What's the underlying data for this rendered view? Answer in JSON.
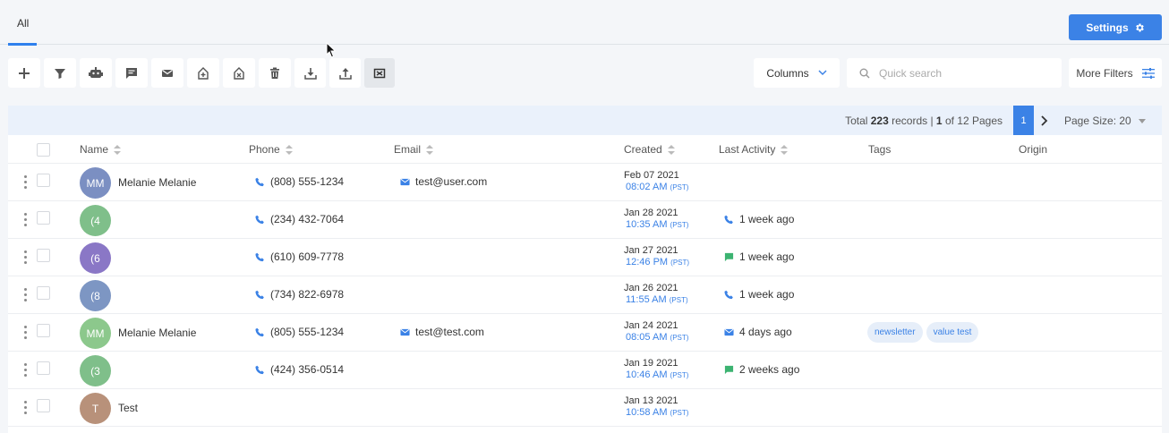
{
  "tabs": [
    {
      "label": "All"
    }
  ],
  "settings_label": "Settings",
  "toolbar": {
    "icons": [
      "plus-icon",
      "filter-icon",
      "robot-icon",
      "chat-icon",
      "mail-icon",
      "tag-add-icon",
      "tag-remove-icon",
      "trash-icon",
      "download-icon",
      "upload-icon",
      "merge-icon"
    ]
  },
  "columns_label": "Columns",
  "search": {
    "placeholder": "Quick search",
    "value": ""
  },
  "more_filters_label": "More Filters",
  "pagination": {
    "total_prefix": "Total ",
    "total_count": "223",
    "records_text": " records | ",
    "page_current": "1",
    "of_text": " of 12 Pages",
    "page_button": "1",
    "page_size": "Page Size: 20"
  },
  "headers": {
    "name": "Name",
    "phone": "Phone",
    "email": "Email",
    "created": "Created",
    "last_activity": "Last Activity",
    "tags": "Tags",
    "origin": "Origin"
  },
  "rows": [
    {
      "initials": "MM",
      "color": "#7b8fc2",
      "name": "Melanie Melanie",
      "phone": "(808) 555-1234",
      "email": "test@user.com",
      "date": "Feb 07 2021",
      "time": "08:02 AM",
      "tz": "(PST)",
      "activity_icon": "",
      "activity": "",
      "tags": []
    },
    {
      "initials": "(4",
      "color": "#7fbf8a",
      "name": "",
      "phone": "(234) 432-7064",
      "email": "",
      "date": "Jan 28 2021",
      "time": "10:35 AM",
      "tz": "(PST)",
      "activity_icon": "phone",
      "activity": "1 week ago",
      "tags": []
    },
    {
      "initials": "(6",
      "color": "#8a77c6",
      "name": "",
      "phone": "(610) 609-7778",
      "email": "",
      "date": "Jan 27 2021",
      "time": "12:46 PM",
      "tz": "(PST)",
      "activity_icon": "chat",
      "activity": "1 week ago",
      "tags": []
    },
    {
      "initials": "(8",
      "color": "#7d96c3",
      "name": "",
      "phone": "(734) 822-6978",
      "email": "",
      "date": "Jan 26 2021",
      "time": "11:55 AM",
      "tz": "(PST)",
      "activity_icon": "phone",
      "activity": "1 week ago",
      "tags": []
    },
    {
      "initials": "MM",
      "color": "#8cc88c",
      "name": "Melanie Melanie",
      "phone": "(805) 555-1234",
      "email": "test@test.com",
      "date": "Jan 24 2021",
      "time": "08:05 AM",
      "tz": "(PST)",
      "activity_icon": "mail",
      "activity": "4 days ago",
      "tags": [
        "newsletter",
        "value test"
      ]
    },
    {
      "initials": "(3",
      "color": "#7fbf8a",
      "name": "",
      "phone": "(424) 356-0514",
      "email": "",
      "date": "Jan 19 2021",
      "time": "10:46 AM",
      "tz": "(PST)",
      "activity_icon": "chat",
      "activity": "2 weeks ago",
      "tags": []
    },
    {
      "initials": "T",
      "color": "#b8917a",
      "name": "Test",
      "phone": "",
      "email": "",
      "date": "Jan 13 2021",
      "time": "10:58 AM",
      "tz": "(PST)",
      "activity_icon": "",
      "activity": "",
      "tags": []
    }
  ],
  "colors": {
    "accent": "#3b82e6",
    "chat_green": "#3cb371"
  }
}
